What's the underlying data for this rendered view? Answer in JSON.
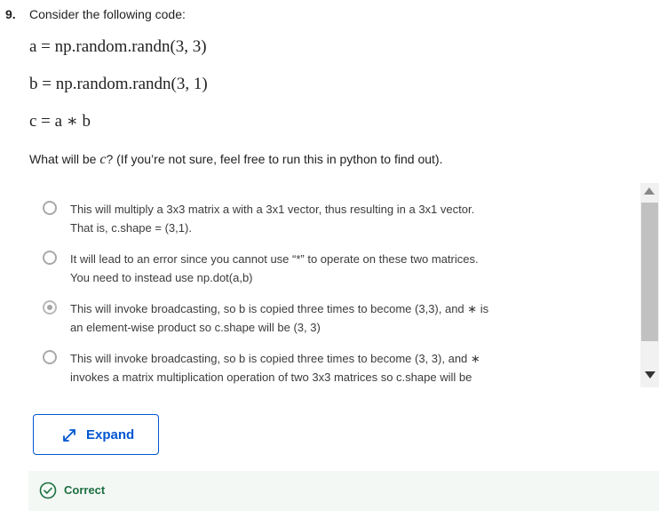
{
  "question": {
    "number": "9.",
    "prompt": "Consider the following code:",
    "code_lines": [
      "a = np.random.randn(3, 3)",
      "b = np.random.randn(3, 1)",
      "c = a ∗ b"
    ],
    "subprompt_prefix": "What will be ",
    "subprompt_var": "c",
    "subprompt_suffix": "? (If you’re not sure, feel free to run this in python to find out)."
  },
  "options": [
    {
      "line1": "This will multiply a 3x3 matrix a with a 3x1 vector, thus resulting in a 3x1 vector.",
      "line2": "That is, c.shape = (3,1).",
      "selected": false
    },
    {
      "line1": "It will lead to an error since you cannot use “*” to operate on these two matrices.",
      "line2": "You need to instead use np.dot(a,b)",
      "selected": false
    },
    {
      "line1": "This will invoke broadcasting, so b is copied three times to become (3,3), and ∗ is",
      "line2": "an element-wise product so c.shape will be (3, 3)",
      "selected": true
    },
    {
      "line1": "This will invoke broadcasting, so b is copied three times to become (3, 3), and ∗",
      "line2": "invokes a matrix multiplication operation of two 3x3 matrices so c.shape will be",
      "selected": false
    }
  ],
  "expand_button": {
    "label": "Expand",
    "icon": "expand-arrows-icon"
  },
  "feedback": {
    "label": "Correct",
    "icon": "check-circle-icon",
    "color": "#1d6f42"
  },
  "colors": {
    "accent": "#0056d2",
    "success": "#1d6f42"
  }
}
